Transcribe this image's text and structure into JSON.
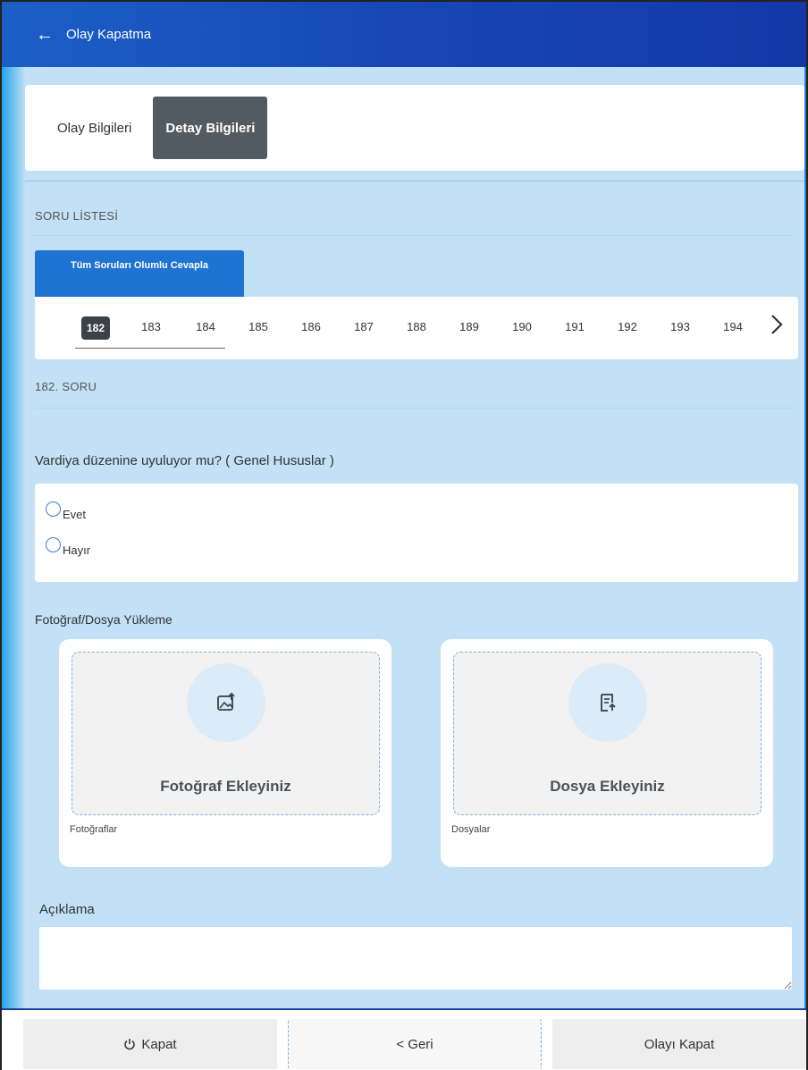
{
  "header": {
    "back_icon": "arrow-left-icon",
    "title": "Olay Kapatma"
  },
  "tabs": [
    {
      "label": "Olay Bilgileri",
      "active": false
    },
    {
      "label": "Detay Bilgileri",
      "active": true
    }
  ],
  "question_list": {
    "label": "SORU LİSTESİ",
    "answer_all_button": "Tüm Soruları Olumlu Cevapla",
    "numbers": [
      "182",
      "183",
      "184",
      "185",
      "186",
      "187",
      "188",
      "189",
      "190",
      "191",
      "192",
      "193",
      "194"
    ],
    "selected": "182",
    "next_icon": "chevron-right-icon"
  },
  "question": {
    "heading": "182. SORU",
    "text": "Vardiya düzenine uyuluyor mu? ( Genel Hususlar )",
    "options": [
      "Evet",
      "Hayır"
    ]
  },
  "upload": {
    "label": "Fotoğraf/Dosya Yükleme",
    "photo": {
      "title": "Fotoğraf Ekleyiniz",
      "caption": "Fotoğraflar",
      "icon": "image-upload-icon"
    },
    "file": {
      "title": "Dosya Ekleyiniz",
      "caption": "Dosyalar",
      "icon": "document-upload-icon"
    }
  },
  "description": {
    "label": "Açıklama",
    "value": ""
  },
  "footer": {
    "close_icon": "power-icon",
    "close_label": "Kapat",
    "back_label": "< Geri",
    "close_event_label": "Olayı Kapat"
  },
  "colors": {
    "header": "#1849b8",
    "accent_button": "#1f73d3",
    "active_tab": "#525a62",
    "panel_background": "#c3e1f6"
  }
}
